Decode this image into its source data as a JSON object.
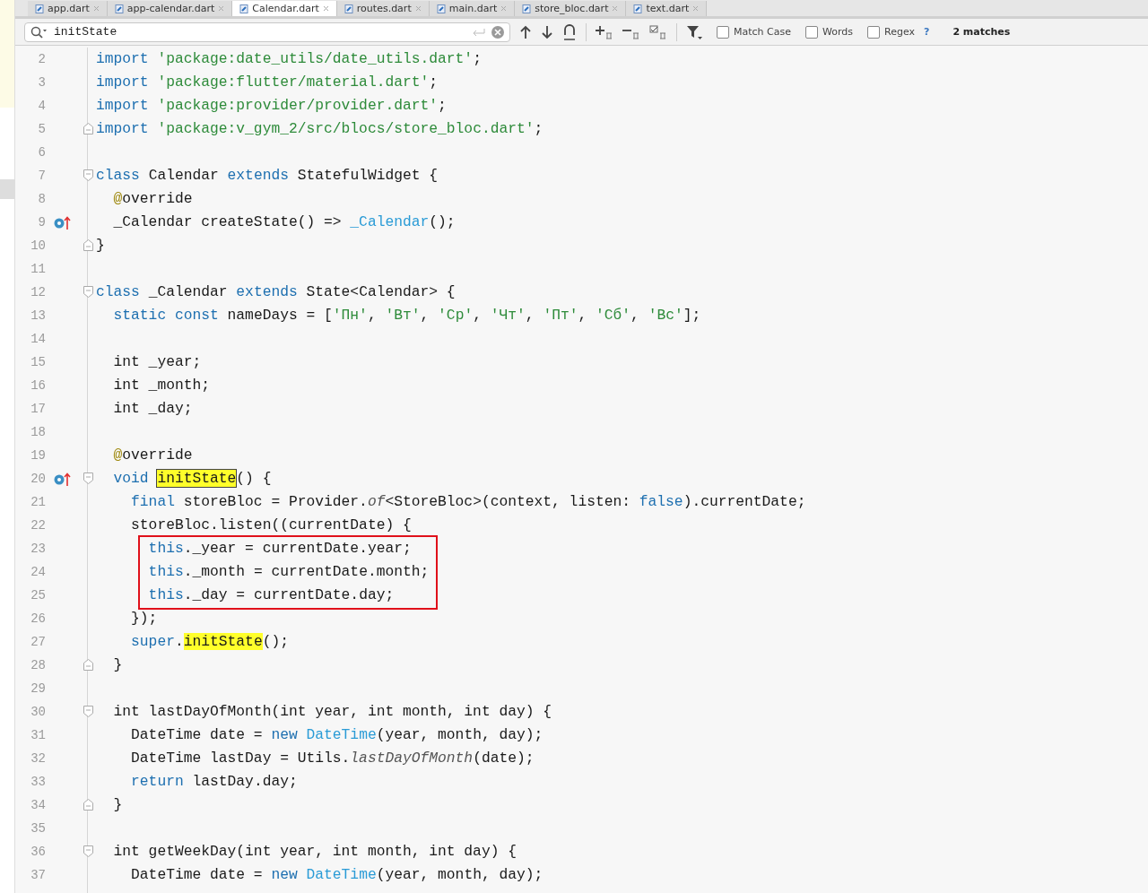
{
  "tabs": [
    {
      "label": "app.dart",
      "selected": false
    },
    {
      "label": "app-calendar.dart",
      "selected": false
    },
    {
      "label": "Calendar.dart",
      "selected": true
    },
    {
      "label": "routes.dart",
      "selected": false
    },
    {
      "label": "main.dart",
      "selected": false
    },
    {
      "label": "store_bloc.dart",
      "selected": false
    },
    {
      "label": "text.dart",
      "selected": false
    }
  ],
  "search": {
    "value": "initState",
    "options": [
      {
        "label": "Match Case",
        "checked": false
      },
      {
        "label": "Words",
        "checked": false
      },
      {
        "label": "Regex",
        "checked": false
      }
    ],
    "help": "?",
    "result": "2 matches"
  },
  "lines": [
    {
      "number": "2",
      "fold_start": false,
      "fold_end": false,
      "override": false,
      "framed": false,
      "tokens": [
        {
          "kind": "kw",
          "text": "import"
        },
        {
          "kind": "str",
          "text": " 'package:date_utils/date_utils.dart'"
        },
        {
          "kind": "plain",
          "text": ";"
        }
      ]
    },
    {
      "number": "3",
      "fold_start": false,
      "fold_end": false,
      "override": false,
      "framed": false,
      "tokens": [
        {
          "kind": "kw",
          "text": "import"
        },
        {
          "kind": "str",
          "text": " 'package:flutter/material.dart'"
        },
        {
          "kind": "plain",
          "text": ";"
        }
      ]
    },
    {
      "number": "4",
      "fold_start": false,
      "fold_end": false,
      "override": false,
      "framed": false,
      "tokens": [
        {
          "kind": "kw",
          "text": "import"
        },
        {
          "kind": "str",
          "text": " 'package:provider/provider.dart'"
        },
        {
          "kind": "plain",
          "text": ";"
        }
      ]
    },
    {
      "number": "5",
      "fold_start": false,
      "fold_end": true,
      "override": false,
      "framed": false,
      "tokens": [
        {
          "kind": "kw",
          "text": "import"
        },
        {
          "kind": "str",
          "text": " 'package:v_gym_2/src/blocs/store_bloc.dart'"
        },
        {
          "kind": "plain",
          "text": ";"
        }
      ]
    },
    {
      "number": "6",
      "fold_start": false,
      "fold_end": false,
      "override": false,
      "framed": false
    },
    {
      "number": "7",
      "fold_start": true,
      "fold_end": false,
      "override": false,
      "framed": false,
      "tokens": [
        {
          "kind": "kw",
          "text": "class"
        },
        {
          "kind": "plain",
          "text": " Calendar "
        },
        {
          "kind": "kw",
          "text": "extends"
        },
        {
          "kind": "plain",
          "text": " StatefulWidget {"
        }
      ]
    },
    {
      "number": "8",
      "fold_start": false,
      "fold_end": false,
      "override": false,
      "framed": false,
      "tokens": [
        {
          "kind": "ann",
          "text": "  @"
        },
        {
          "kind": "plain",
          "text": "override"
        }
      ]
    },
    {
      "number": "9",
      "fold_start": false,
      "fold_end": false,
      "override": true,
      "framed": false,
      "tokens": [
        {
          "kind": "plain",
          "text": "  _Calendar createState() => "
        },
        {
          "kind": "type",
          "text": "_Calendar"
        },
        {
          "kind": "plain",
          "text": "();"
        }
      ]
    },
    {
      "number": "10",
      "fold_start": false,
      "fold_end": true,
      "override": false,
      "framed": false,
      "tokens": [
        {
          "kind": "plain",
          "text": "}"
        }
      ]
    },
    {
      "number": "11",
      "fold_start": false,
      "fold_end": false,
      "override": false,
      "framed": false
    },
    {
      "number": "12",
      "fold_start": true,
      "fold_end": false,
      "override": false,
      "framed": false,
      "tokens": [
        {
          "kind": "kw",
          "text": "class"
        },
        {
          "kind": "plain",
          "text": " _Calendar "
        },
        {
          "kind": "kw",
          "text": "extends"
        },
        {
          "kind": "plain",
          "text": " State<Calendar> {"
        }
      ]
    },
    {
      "number": "13",
      "fold_start": false,
      "fold_end": false,
      "override": false,
      "framed": false,
      "tokens": [
        {
          "kind": "kw",
          "text": "  static const"
        },
        {
          "kind": "plain",
          "text": " nameDays = ["
        },
        {
          "kind": "str",
          "text": "'Пн'"
        },
        {
          "kind": "plain",
          "text": ", "
        },
        {
          "kind": "str",
          "text": "'Вт'"
        },
        {
          "kind": "plain",
          "text": ", "
        },
        {
          "kind": "str",
          "text": "'Ср'"
        },
        {
          "kind": "plain",
          "text": ", "
        },
        {
          "kind": "str",
          "text": "'Чт'"
        },
        {
          "kind": "plain",
          "text": ", "
        },
        {
          "kind": "str",
          "text": "'Пт'"
        },
        {
          "kind": "plain",
          "text": ", "
        },
        {
          "kind": "str",
          "text": "'Сб'"
        },
        {
          "kind": "plain",
          "text": ", "
        },
        {
          "kind": "str",
          "text": "'Вс'"
        },
        {
          "kind": "plain",
          "text": "];"
        }
      ]
    },
    {
      "number": "14",
      "fold_start": false,
      "fold_end": false,
      "override": false,
      "framed": false
    },
    {
      "number": "15",
      "fold_start": false,
      "fold_end": false,
      "override": false,
      "framed": false,
      "tokens": [
        {
          "kind": "plain",
          "text": "  int _year;"
        }
      ]
    },
    {
      "number": "16",
      "fold_start": false,
      "fold_end": false,
      "override": false,
      "framed": false,
      "tokens": [
        {
          "kind": "plain",
          "text": "  int _month;"
        }
      ]
    },
    {
      "number": "17",
      "fold_start": false,
      "fold_end": false,
      "override": false,
      "framed": false,
      "tokens": [
        {
          "kind": "plain",
          "text": "  int _day;"
        }
      ]
    },
    {
      "number": "18",
      "fold_start": false,
      "fold_end": false,
      "override": false,
      "framed": false
    },
    {
      "number": "19",
      "fold_start": false,
      "fold_end": false,
      "override": false,
      "framed": false,
      "tokens": [
        {
          "kind": "ann",
          "text": "  @"
        },
        {
          "kind": "plain",
          "text": "override"
        }
      ]
    },
    {
      "number": "20",
      "fold_start": true,
      "fold_end": false,
      "override": true,
      "framed": false,
      "tokens": [
        {
          "kind": "kw",
          "text": "  void "
        },
        {
          "kind": "current",
          "text": "initState"
        },
        {
          "kind": "plain",
          "text": "() {"
        }
      ]
    },
    {
      "number": "21",
      "fold_start": false,
      "fold_end": false,
      "override": false,
      "framed": false,
      "tokens": [
        {
          "kind": "kw",
          "text": "    final"
        },
        {
          "kind": "plain",
          "text": " storeBloc = Provider."
        },
        {
          "kind": "italic",
          "text": "of"
        },
        {
          "kind": "plain",
          "text": "<StoreBloc>(context, listen: "
        },
        {
          "kind": "kw",
          "text": "false"
        },
        {
          "kind": "plain",
          "text": ").currentDate;"
        }
      ]
    },
    {
      "number": "22",
      "fold_start": false,
      "fold_end": false,
      "override": false,
      "framed": false,
      "tokens": [
        {
          "kind": "plain",
          "text": "    storeBloc.listen((currentDate) {"
        }
      ]
    },
    {
      "number": "23",
      "fold_start": false,
      "fold_end": false,
      "override": false,
      "framed": true,
      "tokens": [
        {
          "kind": "kw",
          "text": "      this"
        },
        {
          "kind": "plain",
          "text": "._year = currentDate.year;"
        }
      ]
    },
    {
      "number": "24",
      "fold_start": false,
      "fold_end": false,
      "override": false,
      "framed": true,
      "tokens": [
        {
          "kind": "kw",
          "text": "      this"
        },
        {
          "kind": "plain",
          "text": "._month = currentDate.month;"
        }
      ]
    },
    {
      "number": "25",
      "fold_start": false,
      "fold_end": false,
      "override": false,
      "framed": true,
      "tokens": [
        {
          "kind": "kw",
          "text": "      this"
        },
        {
          "kind": "plain",
          "text": "._day = currentDate.day;"
        }
      ]
    },
    {
      "number": "26",
      "fold_start": false,
      "fold_end": false,
      "override": false,
      "framed": false,
      "tokens": [
        {
          "kind": "plain",
          "text": "    });"
        }
      ]
    },
    {
      "number": "27",
      "fold_start": false,
      "fold_end": false,
      "override": false,
      "framed": false,
      "tokens": [
        {
          "kind": "kw",
          "text": "    super"
        },
        {
          "kind": "plain",
          "text": "."
        },
        {
          "kind": "match",
          "text": "initState"
        },
        {
          "kind": "plain",
          "text": "();"
        }
      ]
    },
    {
      "number": "28",
      "fold_start": false,
      "fold_end": true,
      "override": false,
      "framed": false,
      "tokens": [
        {
          "kind": "plain",
          "text": "  }"
        }
      ]
    },
    {
      "number": "29",
      "fold_start": false,
      "fold_end": false,
      "override": false,
      "framed": false
    },
    {
      "number": "30",
      "fold_start": true,
      "fold_end": false,
      "override": false,
      "framed": false,
      "tokens": [
        {
          "kind": "plain",
          "text": "  int lastDayOfMonth(int year, int month, int day) {"
        }
      ]
    },
    {
      "number": "31",
      "fold_start": false,
      "fold_end": false,
      "override": false,
      "framed": false,
      "tokens": [
        {
          "kind": "plain",
          "text": "    DateTime date = "
        },
        {
          "kind": "kw",
          "text": "new"
        },
        {
          "kind": "type",
          "text": " DateTime"
        },
        {
          "kind": "plain",
          "text": "(year, month, day);"
        }
      ]
    },
    {
      "number": "32",
      "fold_start": false,
      "fold_end": false,
      "override": false,
      "framed": false,
      "tokens": [
        {
          "kind": "plain",
          "text": "    DateTime lastDay = Utils."
        },
        {
          "kind": "italic",
          "text": "lastDayOfMonth"
        },
        {
          "kind": "plain",
          "text": "(date);"
        }
      ]
    },
    {
      "number": "33",
      "fold_start": false,
      "fold_end": false,
      "override": false,
      "framed": false,
      "tokens": [
        {
          "kind": "kw",
          "text": "    return"
        },
        {
          "kind": "plain",
          "text": " lastDay.day;"
        }
      ]
    },
    {
      "number": "34",
      "fold_start": false,
      "fold_end": true,
      "override": false,
      "framed": false,
      "tokens": [
        {
          "kind": "plain",
          "text": "  }"
        }
      ]
    },
    {
      "number": "35",
      "fold_start": false,
      "fold_end": false,
      "override": false,
      "framed": false
    },
    {
      "number": "36",
      "fold_start": true,
      "fold_end": false,
      "override": false,
      "framed": false,
      "tokens": [
        {
          "kind": "plain",
          "text": "  int getWeekDay(int year, int month, int day) {"
        }
      ]
    },
    {
      "number": "37",
      "fold_start": false,
      "fold_end": false,
      "override": false,
      "framed": false,
      "tokens": [
        {
          "kind": "plain",
          "text": "    DateTime date = "
        },
        {
          "kind": "kw",
          "text": "new"
        },
        {
          "kind": "type",
          "text": " DateTime"
        },
        {
          "kind": "plain",
          "text": "(year, month, day);"
        }
      ]
    }
  ]
}
